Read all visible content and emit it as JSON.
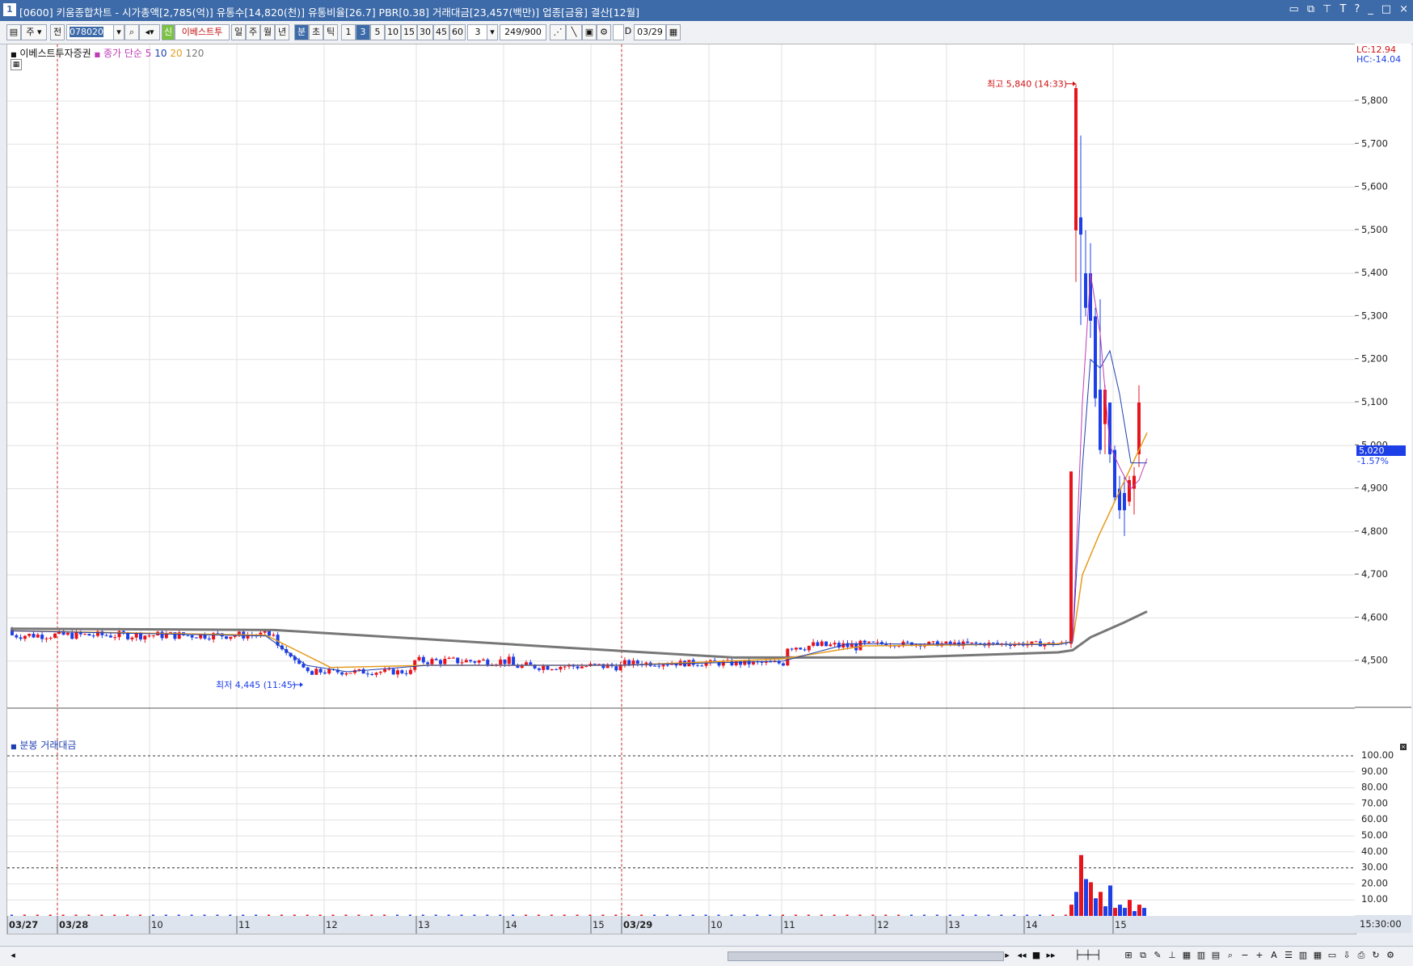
{
  "window": {
    "title_num": "1",
    "title": "[0600] 키움종합차트 - 시가총액[2,785(억)] 유통수[14,820(천)] 유통비율[26.7] PBR[0.38] 거래대금[23,457(백만)] 업종[금융] 결산[12월]"
  },
  "toolbar": {
    "stock_code": "078020",
    "market_prefix": "전",
    "mode_label": "주",
    "new_badge": "신",
    "stock_name": "이베스트투",
    "periods": [
      "일",
      "주",
      "월",
      "년",
      "분",
      "초",
      "틱"
    ],
    "active_period": "분",
    "intervals": [
      "1",
      "3",
      "5",
      "10",
      "15",
      "30",
      "45",
      "60"
    ],
    "active_interval": "3",
    "interval_select": "3",
    "count_display": "249",
    "count_total": "/900",
    "date_label": "D",
    "date_value": "03/29"
  },
  "price_panel": {
    "stock_name_label": "이베스트투자증권",
    "ma_label": "종가 단순",
    "ma5": "5",
    "ma10": "10",
    "ma20": "20",
    "ma120": "120",
    "lc": "LC:12.94",
    "hc": "HC:-14.04",
    "high_annotation": "최고 5,840 (14:33)",
    "low_annotation": "최저 4,445 (11:45)",
    "current_price": "5,020",
    "current_change": "-1.57%",
    "price_ticks": [
      "5,800",
      "5,700",
      "5,600",
      "5,500",
      "5,400",
      "5,300",
      "5,200",
      "5,100",
      "5,000",
      "4,900",
      "4,800",
      "4,700",
      "4,600",
      "4,500"
    ]
  },
  "volume_panel": {
    "label": "분봉 거래대금",
    "ticks": [
      "100.00",
      "90.00",
      "80.00",
      "70.00",
      "60.00",
      "50.00",
      "40.00",
      "30.00",
      "20.00",
      "10.00"
    ]
  },
  "time_axis": {
    "labels": [
      "03/27",
      "03/28",
      "10",
      "11",
      "12",
      "13",
      "14",
      "15",
      "03/29",
      "10",
      "11",
      "12",
      "13",
      "14",
      "15"
    ],
    "end_time": "15:30:00"
  },
  "colors": {
    "up": "#e8141b",
    "down": "#1d3fe8",
    "ma5": "#c03cb5",
    "ma10": "#1d3fb0",
    "ma20": "#e59b1c",
    "ma120": "#777777",
    "title_bg": "#3d6aa8"
  },
  "chart_data": {
    "type": "candlestick",
    "series": [
      {
        "name": "종가 단순 5"
      },
      {
        "name": "10"
      },
      {
        "name": "20"
      },
      {
        "name": "120"
      }
    ],
    "price_range": [
      4430,
      5860
    ],
    "high": {
      "value": 5840,
      "time": "14:33"
    },
    "low": {
      "value": 4445,
      "time": "11:45"
    },
    "last": 5020,
    "volume_range": [
      0,
      100
    ]
  }
}
